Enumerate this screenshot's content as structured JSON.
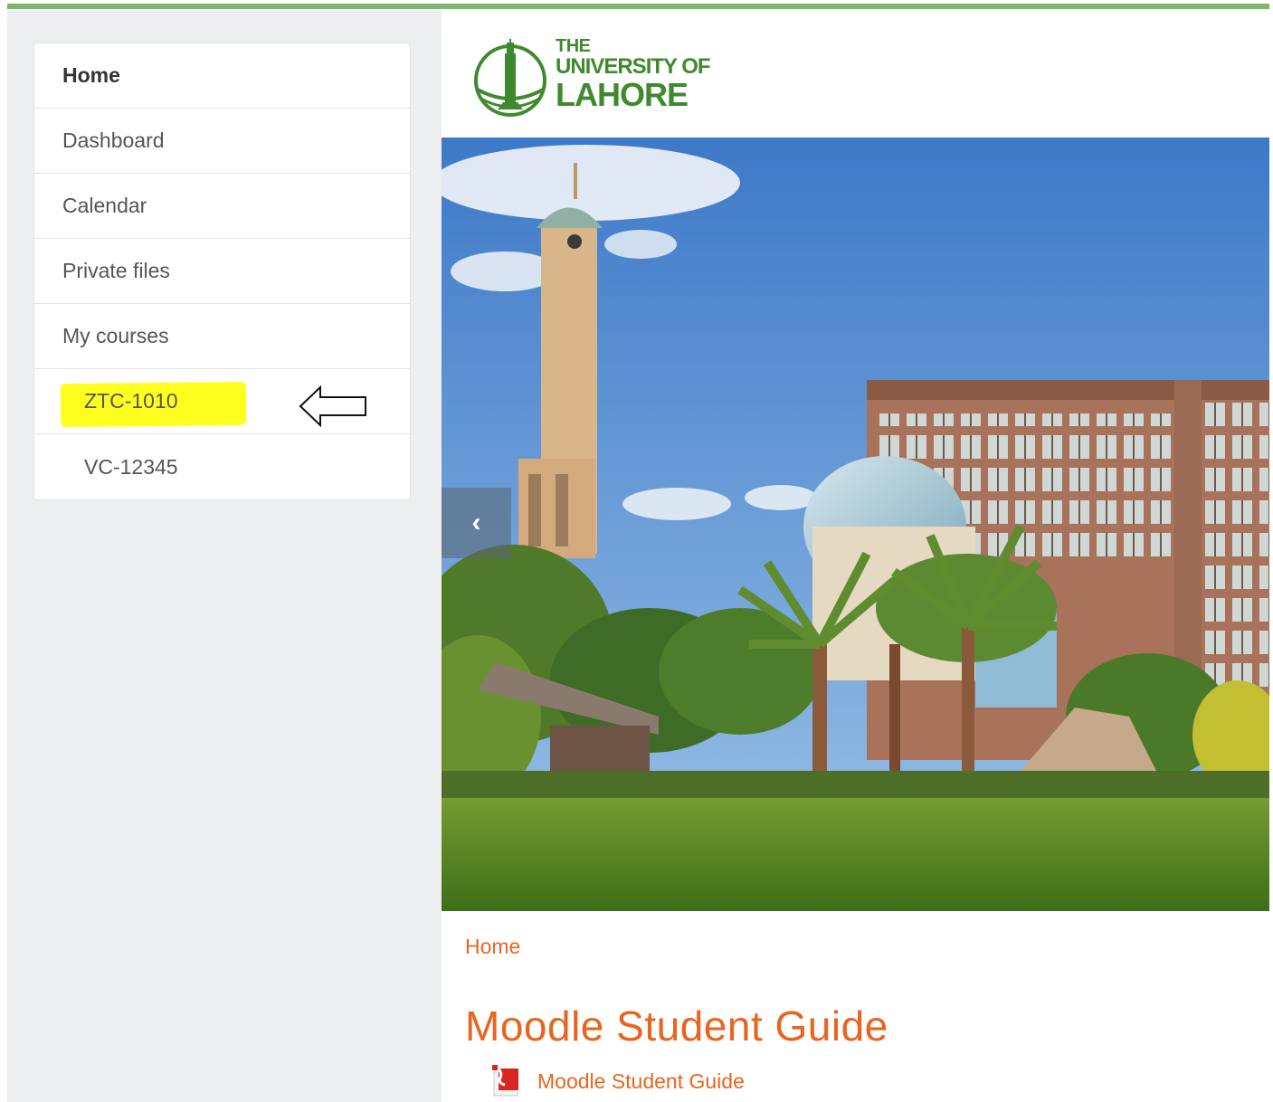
{
  "colors": {
    "accent": "#e8651f",
    "brand_green": "#3f8a2e",
    "top_line": "#7fb56a",
    "highlight": "#ffff1f"
  },
  "sidebar": {
    "items": [
      {
        "label": "Home",
        "bold": true
      },
      {
        "label": "Dashboard"
      },
      {
        "label": "Calendar"
      },
      {
        "label": "Private files"
      },
      {
        "label": "My courses"
      },
      {
        "label": "ZTC-1010",
        "highlighted": true,
        "annotation_icon": "left-arrow-icon"
      },
      {
        "label": "VC-12345"
      }
    ]
  },
  "header": {
    "logo": {
      "line1": "THE",
      "line2": "UNIVERSITY OF",
      "line3": "LAHORE",
      "icon": "minar-logo-icon"
    }
  },
  "carousel": {
    "prev_icon": "chevron-left-icon",
    "prev_glyph": "‹"
  },
  "main": {
    "breadcrumb": "Home",
    "title": "Moodle Student Guide",
    "resource": {
      "label": "Moodle Student Guide",
      "icon": "pdf-icon"
    }
  }
}
